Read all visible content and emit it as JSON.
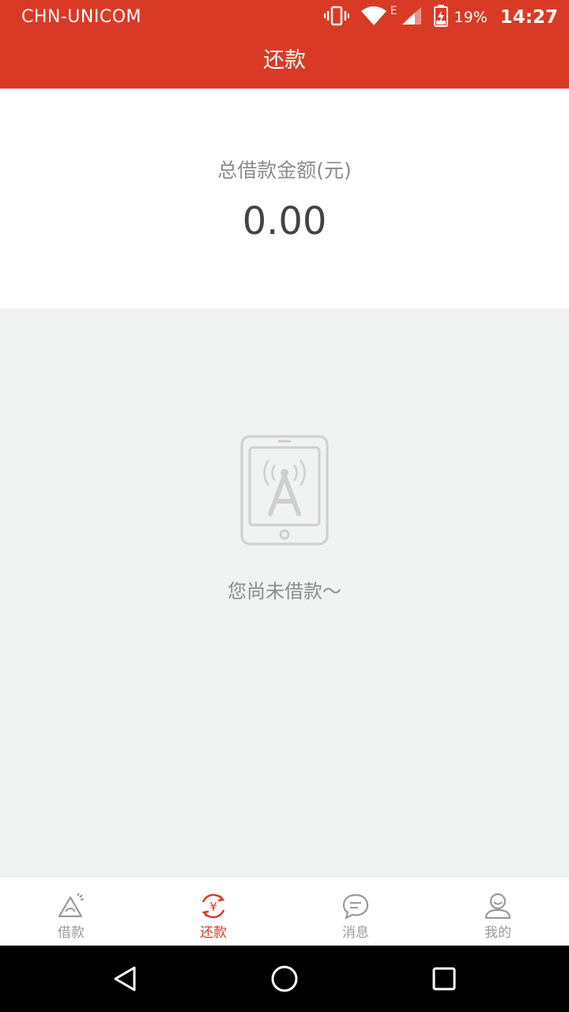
{
  "status_bar": {
    "carrier": "CHN-UNICOM",
    "network_type": "E",
    "battery_percent": "19%",
    "time": "14:27",
    "icons": [
      "vibrate-icon",
      "wifi-icon",
      "signal-icon",
      "battery-icon"
    ]
  },
  "header": {
    "title": "还款"
  },
  "summary": {
    "label": "总借款金额(元)",
    "value": "0.00"
  },
  "empty_state": {
    "icon": "tablet-antenna-icon",
    "message": "您尚未借款～"
  },
  "tabs": [
    {
      "label": "借款",
      "icon": "loan-icon",
      "active": false
    },
    {
      "label": "还款",
      "icon": "repay-yen-icon",
      "active": true
    },
    {
      "label": "消息",
      "icon": "message-icon",
      "active": false
    },
    {
      "label": "我的",
      "icon": "profile-icon",
      "active": false
    }
  ],
  "nav": {
    "buttons": [
      "back-icon",
      "home-icon",
      "recents-icon"
    ]
  },
  "colors": {
    "brand": "#d93a26",
    "muted_text": "#8c8c8c",
    "value_text": "#444444",
    "background": "#f1f2f2"
  }
}
